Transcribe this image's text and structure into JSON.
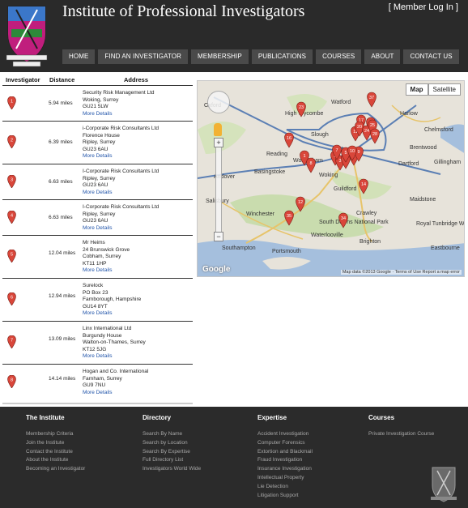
{
  "header": {
    "title": "Institute of Professional Investigators",
    "member_login": "[ Member Log In ]",
    "nav": [
      "HOME",
      "FIND AN INVESTIGATOR",
      "MEMBERSHIP",
      "PUBLICATIONS",
      "COURSES",
      "ABOUT",
      "CONTACT US"
    ]
  },
  "table": {
    "columns": [
      "Investigator",
      "Distance",
      "Address"
    ],
    "rows": [
      {
        "pin": "1",
        "distance": "5.94 miles",
        "address": [
          "Security Risk Management Ltd",
          "Woking, Surrey",
          "GU21 5LW"
        ],
        "more": "More Details"
      },
      {
        "pin": "2",
        "distance": "6.39 miles",
        "address": [
          "i-Corporate Risk Consultants Ltd",
          "Florence House",
          "Ripley, Surrey",
          "GU23 6AU"
        ],
        "more": "More Details"
      },
      {
        "pin": "3",
        "distance": "6.63 miles",
        "address": [
          "I-Corporate Risk Consultants Ltd",
          "Ripley, Surrey",
          "GU23 6AU"
        ],
        "more": "More Details"
      },
      {
        "pin": "4",
        "distance": "6.63 miles",
        "address": [
          "I-Corporate Risk Consultants Ltd",
          "Ripley, Surrey",
          "GU23 6AU"
        ],
        "more": "More Details"
      },
      {
        "pin": "5",
        "distance": "12.04 miles",
        "address": [
          "Mr Heims",
          "24 Brunswick Grove",
          "Cobham, Surrey",
          "KT11 1HP"
        ],
        "more": "More Details"
      },
      {
        "pin": "6",
        "distance": "12.94 miles",
        "address": [
          "Surelock",
          "PO Box 23",
          "Farnborough, Hampshire",
          "GU14 8YT"
        ],
        "more": "More Details"
      },
      {
        "pin": "7",
        "distance": "13.09 miles",
        "address": [
          "Linx International Ltd",
          "Burgundy House",
          "Walton-on-Thames, Surrey",
          "KT12 5JG"
        ],
        "more": "More Details"
      },
      {
        "pin": "8",
        "distance": "14.14 miles",
        "address": [
          "Hogan and Co. International",
          "Farnham, Surrey",
          "GU9 7NU"
        ],
        "more": "More Details"
      }
    ]
  },
  "map": {
    "type_buttons": [
      "Map",
      "Satellite"
    ],
    "credit": "Map data ©2013 Google · Terms of Use   Report a map error",
    "google": "Google",
    "places": [
      "Oxford",
      "High Wycombe",
      "Watford",
      "Harlow",
      "Chelmsford",
      "Brentwood",
      "Slough",
      "London",
      "Reading",
      "Wokingham",
      "Woking",
      "Dartford",
      "Gillingham",
      "Basingstoke",
      "Guildford",
      "Crawley",
      "Maidstone",
      "Winchester",
      "Southampton",
      "Portsmouth",
      "Brighton",
      "Eastbourne",
      "Salisbury",
      "Andover",
      "South Downs National Park",
      "Waterlooville",
      "Royal Tunbridge Wells"
    ],
    "pins": [
      "1",
      "2",
      "3",
      "4",
      "5",
      "6",
      "7",
      "8",
      "9",
      "10",
      "11",
      "12",
      "14",
      "16",
      "17",
      "20",
      "22",
      "23",
      "24",
      "25",
      "28",
      "34",
      "35",
      "37"
    ]
  },
  "footer": {
    "columns": [
      {
        "title": "The Institute",
        "links": [
          "Membership Criteria",
          "Join the Institute",
          "Contact the Institute",
          "About the Institute",
          "Becoming an Investigator"
        ]
      },
      {
        "title": "Directory",
        "links": [
          "Search By Name",
          "Search by Location",
          "Search By Expertise",
          "Full Directory List",
          "Investigators World Wide"
        ]
      },
      {
        "title": "Expertise",
        "links": [
          "Accident Investigation",
          "Computer Forensics",
          "Extortion and Blackmail",
          "Fraud Investigation",
          "Insurance Investigation",
          "Intellectual Property",
          "Lie Detection",
          "Litigation Support"
        ]
      },
      {
        "title": "Courses",
        "links": [
          "Private Investigation Course"
        ]
      }
    ]
  },
  "colors": {
    "header_bg": "#2a2a2a",
    "nav_bg": "#4a4a4a",
    "pin_red": "#d9463a",
    "link_blue": "#2255aa",
    "footer_bg": "#2b2b2b"
  }
}
